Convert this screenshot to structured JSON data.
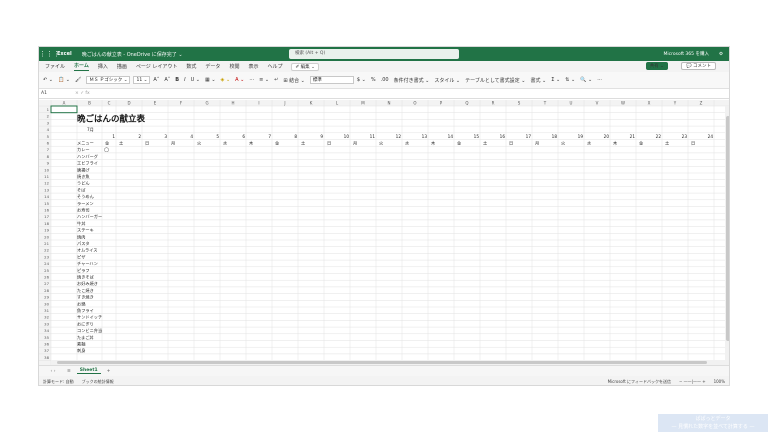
{
  "titlebar": {
    "app_name": "Excel",
    "doc_title": "晩ごはんの献立表 - OneDrive に保存完了 ⌄",
    "search_placeholder": "検索 (Alt + Q)",
    "premium": "Microsoft 365 を購入",
    "gear": "⚙",
    "waffle": "⋮⋮⋮"
  },
  "menu": {
    "items": [
      "ファイル",
      "ホーム",
      "挿入",
      "描画",
      "ページ レイアウト",
      "数式",
      "データ",
      "校閲",
      "表示",
      "ヘルプ"
    ],
    "active_index": 1,
    "edit_mode": "✐ 編集 ⌄",
    "share": "共有 ⌄",
    "comments": "💬 コメント"
  },
  "ribbon": {
    "undo": "↶ ⌄",
    "paste": "📋 ⌄",
    "format_painter": "🖌",
    "font_name": "ＭＳ Ｐゴシック ⌄",
    "font_size": "11 ⌄",
    "grow": "A˄",
    "shrink": "A˅",
    "bold": "B",
    "italic": "I",
    "underline": "U ⌄",
    "border": "▦ ⌄",
    "fill": "◈ ⌄",
    "font_color": "A ⌄",
    "more": "···",
    "align": "≡ ⌄",
    "wrap": "↵",
    "merge": "⊞ 結合 ⌄",
    "number_format": "標準",
    "currency": "$ ⌄",
    "percent": "%",
    "decimals": ".00",
    "cond_format": "条件付き書式 ⌄",
    "styles": "スタイル ⌄",
    "format_as_table": "テーブルとして書式設定 ⌄",
    "cells_format": "書式 ⌄",
    "sum": "Σ ⌄",
    "sort": "⇅ ⌄",
    "find": "🔍 ⌄",
    "overflow": "···"
  },
  "formula_bar": {
    "name_box": "A1",
    "fx": "× ✓ fx"
  },
  "sheet": {
    "col_headers": [
      "A",
      "B",
      "C",
      "D",
      "E",
      "F",
      "G",
      "H",
      "I",
      "J",
      "K",
      "L",
      "M",
      "N",
      "O",
      "P",
      "Q",
      "R",
      "S",
      "T",
      "U",
      "V",
      "W",
      "X",
      "Y",
      "Z"
    ],
    "row_numbers": [
      "1",
      "2",
      "3",
      "4",
      "5",
      "6",
      "7",
      "8",
      "9",
      "10",
      "11",
      "12",
      "13",
      "14",
      "15",
      "16",
      "17",
      "18",
      "19",
      "20",
      "21",
      "22",
      "23",
      "24",
      "25",
      "26",
      "27",
      "28",
      "29",
      "30",
      "31",
      "32",
      "33",
      "34",
      "35",
      "36",
      "37",
      "38"
    ],
    "title": "晩ごはんの献立表",
    "month": "7月",
    "days": [
      "1",
      "2",
      "3",
      "4",
      "5",
      "6",
      "7",
      "8",
      "9",
      "10",
      "11",
      "12",
      "13",
      "14",
      "15",
      "16",
      "17",
      "18",
      "19",
      "20",
      "21",
      "22",
      "23",
      "24"
    ],
    "weekdays": [
      "金",
      "土",
      "日",
      "月",
      "火",
      "水",
      "木",
      "金",
      "土",
      "日",
      "月",
      "火",
      "水",
      "木",
      "金",
      "土",
      "日",
      "月",
      "火",
      "水",
      "木",
      "金",
      "土",
      "日"
    ],
    "menu_header": "メニュー",
    "menus": [
      "カレー",
      "ハンバーグ",
      "エビフライ",
      "唐揚げ",
      "焼き魚",
      "うどん",
      "そば",
      "そうめん",
      "ラーメン",
      "お寿司",
      "ハンバーガー",
      "牛丼",
      "ステーキ",
      "焼肉",
      "パスタ",
      "オムライス",
      "ピザ",
      "チャーハン",
      "ピラフ",
      "焼きそば",
      "お好み焼き",
      "たこ焼き",
      "すき焼き",
      "お鍋",
      "魚フライ",
      "サンドイッチ",
      "おにぎり",
      "コンビニ弁当",
      "たまご丼",
      "素麺",
      "刺身"
    ],
    "mark": "◯"
  },
  "tabs": {
    "nav": "‹  ›",
    "menu_icon": "≡",
    "sheet_name": "Sheet1",
    "add": "+"
  },
  "status": {
    "calc_mode": "計算モード: 自動",
    "workbook_stats": "ブックの統計情報",
    "feedback": "Microsoft にフィードバックを送信",
    "zoom_controls": "−  ——|——  +",
    "zoom": "100%"
  },
  "overlay": {
    "line1": "ぱぱっとデータ",
    "line2": "— 見慣れた数字を並べて計算する —"
  },
  "colors": {
    "excel_green": "#217346",
    "header_bg": "#f3f3f3",
    "grid_line": "#e2e2e2"
  }
}
